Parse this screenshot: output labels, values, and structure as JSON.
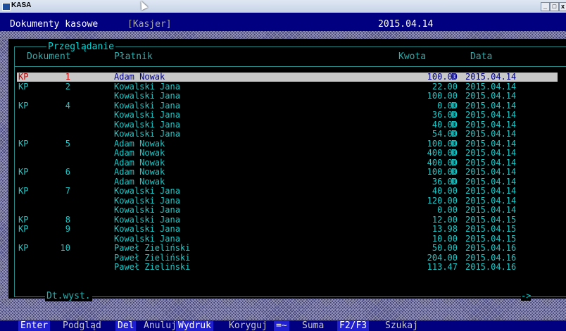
{
  "window": {
    "title": "KASA",
    "controls": [
      "_",
      "□",
      "x"
    ]
  },
  "header": {
    "title": "Dokumenty kasowe",
    "role": "[Kasjer]",
    "date": "2015.04.14"
  },
  "panel": {
    "title": "Przeglądanie",
    "columns": {
      "document": "Dokument",
      "payer": "Płatnik",
      "amount": "Kwota",
      "date": "Data"
    },
    "footer_label": "Dt.wyst.",
    "scroll_arrow": "->"
  },
  "rows": [
    {
      "kind": "KP",
      "num": "1",
      "name": "Adam Nowak",
      "amount": "100.00",
      "flag": "D",
      "date": "2015.04.14"
    },
    {
      "kind": "KP",
      "num": "2",
      "name": "Kowalski Jana",
      "amount": "22.00",
      "flag": "",
      "date": "2015.04.14"
    },
    {
      "kind": "",
      "num": "",
      "name": "Kowalski Jana",
      "amount": "100.00",
      "flag": "",
      "date": "2015.04.14"
    },
    {
      "kind": "KP",
      "num": "4",
      "name": "Kowalski Jana",
      "amount": "0.00",
      "flag": "D",
      "date": "2015.04.14"
    },
    {
      "kind": "",
      "num": "",
      "name": "Kowalski Jana",
      "amount": "36.00",
      "flag": "D",
      "date": "2015.04.14"
    },
    {
      "kind": "",
      "num": "",
      "name": "Kowalski Jana",
      "amount": "40.00",
      "flag": "D",
      "date": "2015.04.14"
    },
    {
      "kind": "",
      "num": "",
      "name": "Kowalski Jana",
      "amount": "54.00",
      "flag": "D",
      "date": "2015.04.14"
    },
    {
      "kind": "KP",
      "num": "5",
      "name": "Adam Nowak",
      "amount": "100.00",
      "flag": "D",
      "date": "2015.04.14"
    },
    {
      "kind": "",
      "num": "",
      "name": "Adam Nowak",
      "amount": "400.00",
      "flag": "D",
      "date": "2015.04.14"
    },
    {
      "kind": "",
      "num": "",
      "name": "Adam Nowak",
      "amount": "400.00",
      "flag": "D",
      "date": "2015.04.14"
    },
    {
      "kind": "KP",
      "num": "6",
      "name": "Adam Nowak",
      "amount": "100.00",
      "flag": "D",
      "date": "2015.04.14"
    },
    {
      "kind": "",
      "num": "",
      "name": "Adam Nowak",
      "amount": "36.00",
      "flag": "D",
      "date": "2015.04.14"
    },
    {
      "kind": "KP",
      "num": "7",
      "name": "Kowalski Jana",
      "amount": "40.00",
      "flag": "",
      "date": "2015.04.14"
    },
    {
      "kind": "",
      "num": "",
      "name": "Kowalski Jana",
      "amount": "120.00",
      "flag": "",
      "date": "2015.04.14"
    },
    {
      "kind": "",
      "num": "",
      "name": "Kowalski Jana",
      "amount": "0.00",
      "flag": "",
      "date": "2015.04.14"
    },
    {
      "kind": "KP",
      "num": "8",
      "name": "Kowalski Jana",
      "amount": "12.00",
      "flag": "",
      "date": "2015.04.15"
    },
    {
      "kind": "KP",
      "num": "9",
      "name": "Kowalski Jana",
      "amount": "13.98",
      "flag": "",
      "date": "2015.04.15"
    },
    {
      "kind": "",
      "num": "",
      "name": "Kowalski Jana",
      "amount": "10.00",
      "flag": "",
      "date": "2015.04.15"
    },
    {
      "kind": "KP",
      "num": "10",
      "name": "Paweł Zieliński",
      "amount": "50.00",
      "flag": "",
      "date": "2015.04.16"
    },
    {
      "kind": "",
      "num": "",
      "name": "Paweł Zieliński",
      "amount": "204.00",
      "flag": "",
      "date": "2015.04.16"
    },
    {
      "kind": "",
      "num": "",
      "name": "Paweł Zieliński",
      "amount": "113.47",
      "flag": "",
      "date": "2015.04.16"
    }
  ],
  "selected_row": 0,
  "footer_keys": [
    {
      "key": "Enter",
      "label": "Podgląd"
    },
    {
      "key": "Del",
      "label": "Anuluj"
    },
    {
      "key": "Wydruk",
      "label": "Koryguj"
    },
    {
      "key": "=~",
      "label": "Suma"
    },
    {
      "key": "F2/F3",
      "label": "Szukaj"
    }
  ],
  "colors": {
    "background": "#000080",
    "panel": "#000000",
    "text": "#1ec8c8",
    "selection": "#c8c8c8",
    "key_bg": "#2020d0"
  }
}
